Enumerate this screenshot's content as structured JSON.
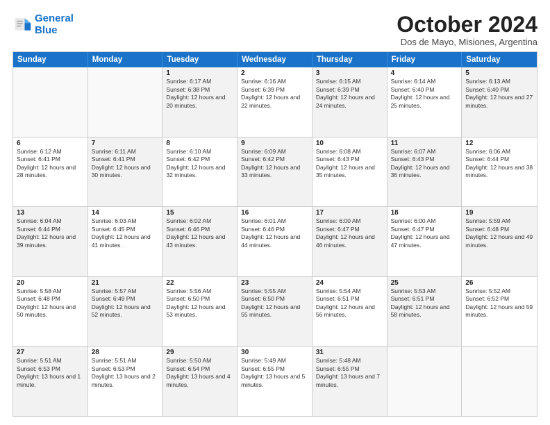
{
  "header": {
    "logo_line1": "General",
    "logo_line2": "Blue",
    "main_title": "October 2024",
    "subtitle": "Dos de Mayo, Misiones, Argentina"
  },
  "days_of_week": [
    "Sunday",
    "Monday",
    "Tuesday",
    "Wednesday",
    "Thursday",
    "Friday",
    "Saturday"
  ],
  "weeks": [
    [
      {
        "day": "",
        "sunrise": "",
        "sunset": "",
        "daylight": "",
        "empty": true
      },
      {
        "day": "",
        "sunrise": "",
        "sunset": "",
        "daylight": "",
        "empty": true
      },
      {
        "day": "1",
        "sunrise": "Sunrise: 6:17 AM",
        "sunset": "Sunset: 6:38 PM",
        "daylight": "Daylight: 12 hours and 20 minutes.",
        "shaded": true
      },
      {
        "day": "2",
        "sunrise": "Sunrise: 6:16 AM",
        "sunset": "Sunset: 6:39 PM",
        "daylight": "Daylight: 12 hours and 22 minutes.",
        "shaded": false
      },
      {
        "day": "3",
        "sunrise": "Sunrise: 6:15 AM",
        "sunset": "Sunset: 6:39 PM",
        "daylight": "Daylight: 12 hours and 24 minutes.",
        "shaded": true
      },
      {
        "day": "4",
        "sunrise": "Sunrise: 6:14 AM",
        "sunset": "Sunset: 6:40 PM",
        "daylight": "Daylight: 12 hours and 25 minutes.",
        "shaded": false
      },
      {
        "day": "5",
        "sunrise": "Sunrise: 6:13 AM",
        "sunset": "Sunset: 6:40 PM",
        "daylight": "Daylight: 12 hours and 27 minutes.",
        "shaded": true
      }
    ],
    [
      {
        "day": "6",
        "sunrise": "Sunrise: 6:12 AM",
        "sunset": "Sunset: 6:41 PM",
        "daylight": "Daylight: 12 hours and 28 minutes.",
        "shaded": false
      },
      {
        "day": "7",
        "sunrise": "Sunrise: 6:11 AM",
        "sunset": "Sunset: 6:41 PM",
        "daylight": "Daylight: 12 hours and 30 minutes.",
        "shaded": true
      },
      {
        "day": "8",
        "sunrise": "Sunrise: 6:10 AM",
        "sunset": "Sunset: 6:42 PM",
        "daylight": "Daylight: 12 hours and 32 minutes.",
        "shaded": false
      },
      {
        "day": "9",
        "sunrise": "Sunrise: 6:09 AM",
        "sunset": "Sunset: 6:42 PM",
        "daylight": "Daylight: 12 hours and 33 minutes.",
        "shaded": true
      },
      {
        "day": "10",
        "sunrise": "Sunrise: 6:08 AM",
        "sunset": "Sunset: 6:43 PM",
        "daylight": "Daylight: 12 hours and 35 minutes.",
        "shaded": false
      },
      {
        "day": "11",
        "sunrise": "Sunrise: 6:07 AM",
        "sunset": "Sunset: 6:43 PM",
        "daylight": "Daylight: 12 hours and 36 minutes.",
        "shaded": true
      },
      {
        "day": "12",
        "sunrise": "Sunrise: 6:06 AM",
        "sunset": "Sunset: 6:44 PM",
        "daylight": "Daylight: 12 hours and 38 minutes.",
        "shaded": false
      }
    ],
    [
      {
        "day": "13",
        "sunrise": "Sunrise: 6:04 AM",
        "sunset": "Sunset: 6:44 PM",
        "daylight": "Daylight: 12 hours and 39 minutes.",
        "shaded": true
      },
      {
        "day": "14",
        "sunrise": "Sunrise: 6:03 AM",
        "sunset": "Sunset: 6:45 PM",
        "daylight": "Daylight: 12 hours and 41 minutes.",
        "shaded": false
      },
      {
        "day": "15",
        "sunrise": "Sunrise: 6:02 AM",
        "sunset": "Sunset: 6:46 PM",
        "daylight": "Daylight: 12 hours and 43 minutes.",
        "shaded": true
      },
      {
        "day": "16",
        "sunrise": "Sunrise: 6:01 AM",
        "sunset": "Sunset: 6:46 PM",
        "daylight": "Daylight: 12 hours and 44 minutes.",
        "shaded": false
      },
      {
        "day": "17",
        "sunrise": "Sunrise: 6:00 AM",
        "sunset": "Sunset: 6:47 PM",
        "daylight": "Daylight: 12 hours and 46 minutes.",
        "shaded": true
      },
      {
        "day": "18",
        "sunrise": "Sunrise: 6:00 AM",
        "sunset": "Sunset: 6:47 PM",
        "daylight": "Daylight: 12 hours and 47 minutes.",
        "shaded": false
      },
      {
        "day": "19",
        "sunrise": "Sunrise: 5:59 AM",
        "sunset": "Sunset: 6:48 PM",
        "daylight": "Daylight: 12 hours and 49 minutes.",
        "shaded": true
      }
    ],
    [
      {
        "day": "20",
        "sunrise": "Sunrise: 5:58 AM",
        "sunset": "Sunset: 6:48 PM",
        "daylight": "Daylight: 12 hours and 50 minutes.",
        "shaded": false
      },
      {
        "day": "21",
        "sunrise": "Sunrise: 5:57 AM",
        "sunset": "Sunset: 6:49 PM",
        "daylight": "Daylight: 12 hours and 52 minutes.",
        "shaded": true
      },
      {
        "day": "22",
        "sunrise": "Sunrise: 5:56 AM",
        "sunset": "Sunset: 6:50 PM",
        "daylight": "Daylight: 12 hours and 53 minutes.",
        "shaded": false
      },
      {
        "day": "23",
        "sunrise": "Sunrise: 5:55 AM",
        "sunset": "Sunset: 6:50 PM",
        "daylight": "Daylight: 12 hours and 55 minutes.",
        "shaded": true
      },
      {
        "day": "24",
        "sunrise": "Sunrise: 5:54 AM",
        "sunset": "Sunset: 6:51 PM",
        "daylight": "Daylight: 12 hours and 56 minutes.",
        "shaded": false
      },
      {
        "day": "25",
        "sunrise": "Sunrise: 5:53 AM",
        "sunset": "Sunset: 6:51 PM",
        "daylight": "Daylight: 12 hours and 58 minutes.",
        "shaded": true
      },
      {
        "day": "26",
        "sunrise": "Sunrise: 5:52 AM",
        "sunset": "Sunset: 6:52 PM",
        "daylight": "Daylight: 12 hours and 59 minutes.",
        "shaded": false
      }
    ],
    [
      {
        "day": "27",
        "sunrise": "Sunrise: 5:51 AM",
        "sunset": "Sunset: 6:53 PM",
        "daylight": "Daylight: 13 hours and 1 minute.",
        "shaded": true
      },
      {
        "day": "28",
        "sunrise": "Sunrise: 5:51 AM",
        "sunset": "Sunset: 6:53 PM",
        "daylight": "Daylight: 13 hours and 2 minutes.",
        "shaded": false
      },
      {
        "day": "29",
        "sunrise": "Sunrise: 5:50 AM",
        "sunset": "Sunset: 6:54 PM",
        "daylight": "Daylight: 13 hours and 4 minutes.",
        "shaded": true
      },
      {
        "day": "30",
        "sunrise": "Sunrise: 5:49 AM",
        "sunset": "Sunset: 6:55 PM",
        "daylight": "Daylight: 13 hours and 5 minutes.",
        "shaded": false
      },
      {
        "day": "31",
        "sunrise": "Sunrise: 5:48 AM",
        "sunset": "Sunset: 6:55 PM",
        "daylight": "Daylight: 13 hours and 7 minutes.",
        "shaded": true
      },
      {
        "day": "",
        "sunrise": "",
        "sunset": "",
        "daylight": "",
        "empty": true
      },
      {
        "day": "",
        "sunrise": "",
        "sunset": "",
        "daylight": "",
        "empty": true
      }
    ]
  ]
}
